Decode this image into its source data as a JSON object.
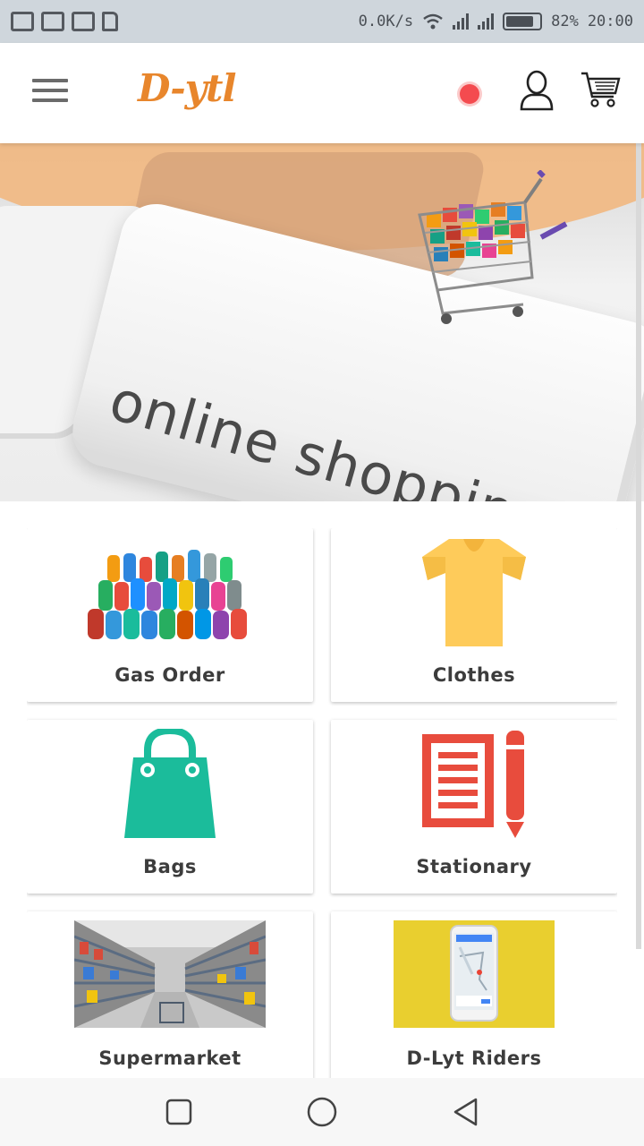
{
  "status_bar": {
    "icons": [
      "gmail-icon",
      "gmail-icon",
      "gallery-icon",
      "file-icon"
    ],
    "net_speed": "0.0K/s",
    "battery": "82%",
    "battery_level": 0.82,
    "time": "20:00"
  },
  "app_bar": {
    "logo": "D-ytl",
    "notification_color": "#f44b4f"
  },
  "hero": {
    "caption": "online shopping"
  },
  "categories": [
    {
      "label": "Gas Order",
      "icon": "gas-cylinders-image"
    },
    {
      "label": "Clothes",
      "icon": "tshirt-icon"
    },
    {
      "label": "Bags",
      "icon": "shopping-bag-icon"
    },
    {
      "label": "Stationary",
      "icon": "notepad-pencil-icon"
    },
    {
      "label": "Supermarket",
      "icon": "supermarket-aisle-image"
    },
    {
      "label": "D-Lyt Riders",
      "icon": "phone-map-image"
    }
  ],
  "colors": {
    "accent": "#e8862c",
    "tshirt": "#fecb5a",
    "bag": "#1bbc9b",
    "stationery": "#e84c3d"
  }
}
